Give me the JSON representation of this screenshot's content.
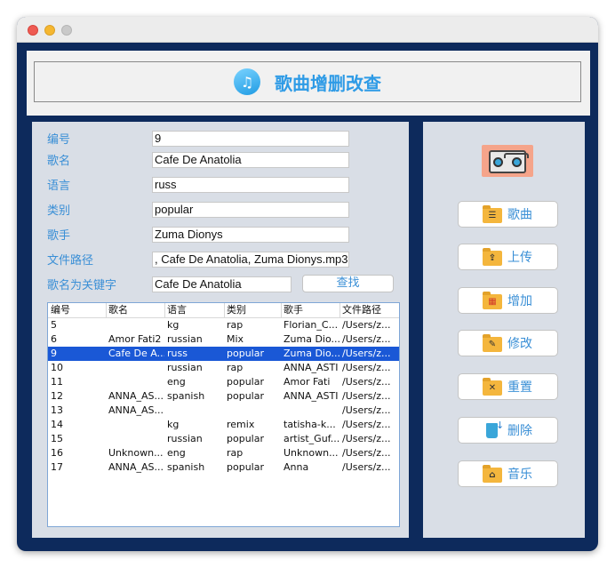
{
  "header": {
    "title": "歌曲增删改查",
    "logo_icon": "music-note-icon"
  },
  "form": {
    "fields": [
      {
        "label": "编号",
        "value": "9"
      },
      {
        "label": "歌名",
        "value": "Cafe De Anatolia"
      },
      {
        "label": "语言",
        "value": "russ"
      },
      {
        "label": "类别",
        "value": "popular"
      },
      {
        "label": "歌手",
        "value": "Zuma Dionys"
      },
      {
        "label": "文件路径",
        "value": ", Cafe De Anatolia, Zuma Dionys.mp3"
      }
    ],
    "search": {
      "label": "歌名为关键字",
      "value": "Cafe De Anatolia",
      "button": "查找"
    }
  },
  "table": {
    "headers": [
      "编号",
      "歌名",
      "语言",
      "类别",
      "歌手",
      "文件路径"
    ],
    "selected_row": 2,
    "rows": [
      [
        "5",
        "",
        "kg",
        "rap",
        "Florian_C...",
        "/Users/z..."
      ],
      [
        "6",
        "Amor Fati2",
        "russian",
        "Mix",
        "Zuma Dio...",
        "/Users/z..."
      ],
      [
        "9",
        "Cafe De A...",
        "russ",
        "popular",
        "Zuma Dio...",
        "/Users/z..."
      ],
      [
        "10",
        "",
        "russian",
        "rap",
        "ANNA_ASTI",
        "/Users/z..."
      ],
      [
        "11",
        "",
        "eng",
        "popular",
        "Amor Fati",
        "/Users/z..."
      ],
      [
        "12",
        "ANNA_AS...",
        "spanish",
        "popular",
        "ANNA_ASTI",
        "/Users/z..."
      ],
      [
        "13",
        "ANNA_AS...",
        "",
        "",
        "",
        "/Users/z..."
      ],
      [
        "14",
        "",
        "kg",
        "remix",
        "tatisha-k...",
        "/Users/z..."
      ],
      [
        "15",
        "",
        "russian",
        "popular",
        "artist_Guf...",
        "/Users/z..."
      ],
      [
        "16",
        "Unknown...",
        "eng",
        "rap",
        "Unknown...",
        "/Users/z..."
      ],
      [
        "17",
        "ANNA_AS...",
        "spanish",
        "popular",
        "Anna",
        "/Users/z..."
      ]
    ]
  },
  "sidebar": {
    "image_icon": "boombox-icon",
    "buttons": [
      {
        "label": "歌曲",
        "icon": "folder-list-icon"
      },
      {
        "label": "上传",
        "icon": "folder-upload-icon"
      },
      {
        "label": "增加",
        "icon": "folder-add-icon"
      },
      {
        "label": "修改",
        "icon": "folder-edit-icon"
      },
      {
        "label": "重置",
        "icon": "folder-tools-icon"
      },
      {
        "label": "删除",
        "icon": "trash-icon"
      },
      {
        "label": "音乐",
        "icon": "folder-home-icon"
      }
    ]
  }
}
